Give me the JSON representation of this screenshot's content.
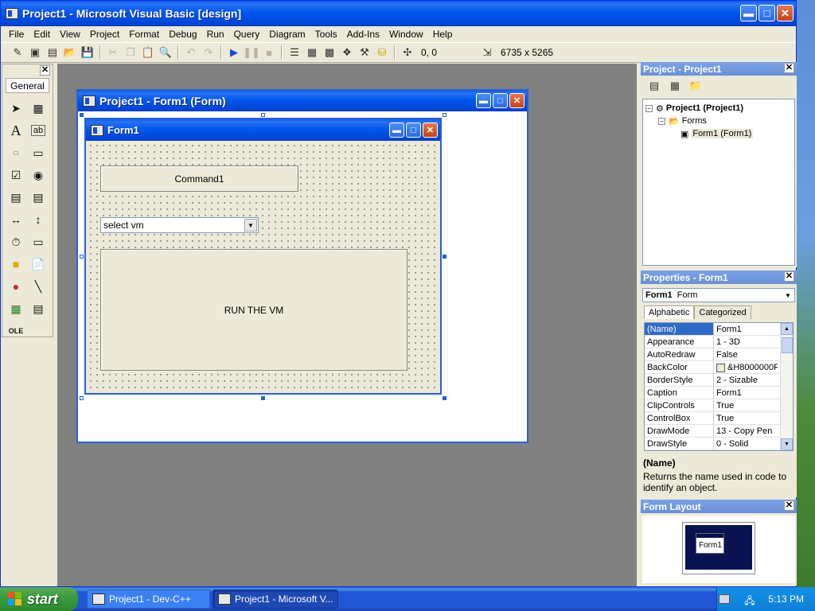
{
  "window": {
    "title": "Project1 - Microsoft Visual Basic [design]"
  },
  "menu": [
    "File",
    "Edit",
    "View",
    "Project",
    "Format",
    "Debug",
    "Run",
    "Query",
    "Diagram",
    "Tools",
    "Add-Ins",
    "Window",
    "Help"
  ],
  "toolbar": {
    "position": "0, 0",
    "size": "6735 x 5265"
  },
  "toolbox": {
    "tab": "General"
  },
  "designer": {
    "title": "Project1 - Form1 (Form)"
  },
  "form": {
    "title": "Form1",
    "command1_caption": "Command1",
    "combo_text": "select vm",
    "run_caption": "RUN THE VM"
  },
  "project_panel": {
    "title": "Project - Project1",
    "tree": {
      "project": "Project1 (Project1)",
      "folder": "Forms",
      "form": "Form1 (Form1)"
    }
  },
  "properties_panel": {
    "title": "Properties - Form1",
    "object_name": "Form1",
    "object_type": "Form",
    "tabs": [
      "Alphabetic",
      "Categorized"
    ],
    "rows": [
      {
        "name": "(Name)",
        "value": "Form1"
      },
      {
        "name": "Appearance",
        "value": "1 - 3D"
      },
      {
        "name": "AutoRedraw",
        "value": "False"
      },
      {
        "name": "BackColor",
        "value": "&H8000000F"
      },
      {
        "name": "BorderStyle",
        "value": "2 - Sizable"
      },
      {
        "name": "Caption",
        "value": "Form1"
      },
      {
        "name": "ClipControls",
        "value": "True"
      },
      {
        "name": "ControlBox",
        "value": "True"
      },
      {
        "name": "DrawMode",
        "value": "13 - Copy Pen"
      },
      {
        "name": "DrawStyle",
        "value": "0 - Solid"
      }
    ],
    "desc_title": "(Name)",
    "desc_text": "Returns the name used in code to identify an object."
  },
  "layout_panel": {
    "title": "Form Layout",
    "form_label": "Form1"
  },
  "taskbar": {
    "start": "start",
    "tasks": [
      "Project1 - Dev-C++",
      "Project1 - Microsoft V..."
    ],
    "clock": "5:13 PM"
  },
  "colors": {
    "titlebar": "#0058ee",
    "selection": "#316ac5",
    "workspace": "#808080",
    "close": "#c3421c"
  }
}
